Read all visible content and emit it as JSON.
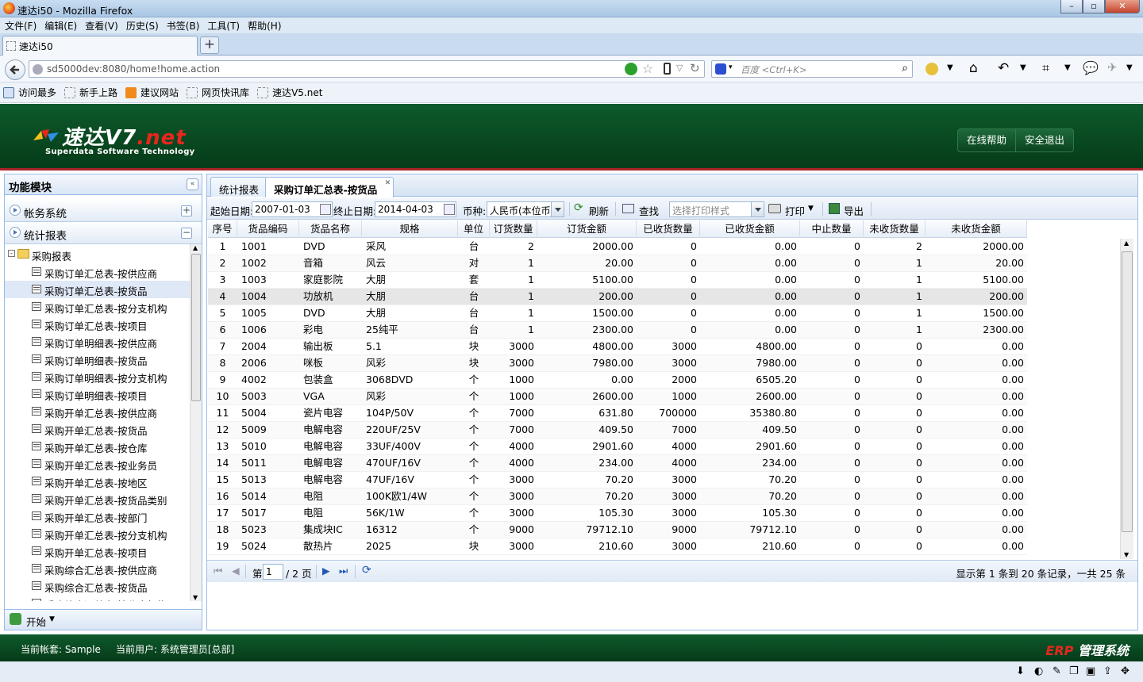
{
  "window": {
    "title": "速达i50 - Mozilla Firefox"
  },
  "menu": [
    "文件(F)",
    "编辑(E)",
    "查看(V)",
    "历史(S)",
    "书签(B)",
    "工具(T)",
    "帮助(H)"
  ],
  "browser_tab": {
    "label": "速达i50"
  },
  "address": {
    "url": "sd5000dev:8080/home!home.action",
    "search_placeholder": "百度 <Ctrl+K>"
  },
  "bookmarks": [
    "访问最多",
    "新手上路",
    "建议网站",
    "网页快讯库",
    "速达V5.net"
  ],
  "app": {
    "logo_main": "速达V7",
    "logo_net": ".net",
    "logo_sub": "Superdata Software Technology",
    "help_button": "在线帮助",
    "logout_button": "安全退出"
  },
  "sidebar": {
    "title": "功能模块",
    "sections": [
      {
        "label": "帐务系统",
        "toggle": "+"
      },
      {
        "label": "统计报表",
        "toggle": "−"
      }
    ],
    "folder": "采购报表",
    "items": [
      "采购订单汇总表-按供应商",
      "采购订单汇总表-按货品",
      "采购订单汇总表-按分支机构",
      "采购订单汇总表-按项目",
      "采购订单明细表-按供应商",
      "采购订单明细表-按货品",
      "采购订单明细表-按分支机构",
      "采购订单明细表-按项目",
      "采购开单汇总表-按供应商",
      "采购开单汇总表-按货品",
      "采购开单汇总表-按仓库",
      "采购开单汇总表-按业务员",
      "采购开单汇总表-按地区",
      "采购开单汇总表-按货品类别",
      "采购开单汇总表-按部门",
      "采购开单汇总表-按分支机构",
      "采购开单汇总表-按项目",
      "采购综合汇总表-按供应商",
      "采购综合汇总表-按货品",
      "采购综合汇总表-按分支机构"
    ],
    "selected_index": 1,
    "start": "开始"
  },
  "tabs": [
    {
      "label": "统计报表"
    },
    {
      "label": "采购订单汇总表-按货品"
    }
  ],
  "toolbar": {
    "start_label": "起始日期:",
    "start_value": "2007-01-03",
    "end_label": "终止日期:",
    "end_value": "2014-04-03",
    "currency_label": "币种:",
    "currency_value": "人民币(本位币",
    "refresh": "刷新",
    "find": "查找",
    "print_style_placeholder": "选择打印样式",
    "print": "打印",
    "export": "导出"
  },
  "table": {
    "columns": [
      "序号",
      "货品编码",
      "货品名称",
      "规格",
      "单位",
      "订货数量",
      "订货金额",
      "已收货数量",
      "已收货金额",
      "中止数量",
      "未收货数量",
      "未收货金额"
    ],
    "rows": [
      [
        "1",
        "1001",
        "DVD",
        "采风",
        "台",
        "2",
        "2000.00",
        "0",
        "0.00",
        "0",
        "2",
        "2000.00"
      ],
      [
        "2",
        "1002",
        "音箱",
        "风云",
        "对",
        "1",
        "20.00",
        "0",
        "0.00",
        "0",
        "1",
        "20.00"
      ],
      [
        "3",
        "1003",
        "家庭影院",
        "大朋",
        "套",
        "1",
        "5100.00",
        "0",
        "0.00",
        "0",
        "1",
        "5100.00"
      ],
      [
        "4",
        "1004",
        "功放机",
        "大朋",
        "台",
        "1",
        "200.00",
        "0",
        "0.00",
        "0",
        "1",
        "200.00"
      ],
      [
        "5",
        "1005",
        "DVD",
        "大朋",
        "台",
        "1",
        "1500.00",
        "0",
        "0.00",
        "0",
        "1",
        "1500.00"
      ],
      [
        "6",
        "1006",
        "彩电",
        "25纯平",
        "台",
        "1",
        "2300.00",
        "0",
        "0.00",
        "0",
        "1",
        "2300.00"
      ],
      [
        "7",
        "2004",
        "输出板",
        "5.1",
        "块",
        "3000",
        "4800.00",
        "3000",
        "4800.00",
        "0",
        "0",
        "0.00"
      ],
      [
        "8",
        "2006",
        "咪板",
        "风彩",
        "块",
        "3000",
        "7980.00",
        "3000",
        "7980.00",
        "0",
        "0",
        "0.00"
      ],
      [
        "9",
        "4002",
        "包装盒",
        "3068DVD",
        "个",
        "1000",
        "0.00",
        "2000",
        "6505.20",
        "0",
        "0",
        "0.00"
      ],
      [
        "10",
        "5003",
        "VGA",
        "风彩",
        "个",
        "1000",
        "2600.00",
        "1000",
        "2600.00",
        "0",
        "0",
        "0.00"
      ],
      [
        "11",
        "5004",
        "瓷片电容",
        "104P/50V",
        "个",
        "7000",
        "631.80",
        "700000",
        "35380.80",
        "0",
        "0",
        "0.00"
      ],
      [
        "12",
        "5009",
        "电解电容",
        "220UF/25V",
        "个",
        "7000",
        "409.50",
        "7000",
        "409.50",
        "0",
        "0",
        "0.00"
      ],
      [
        "13",
        "5010",
        "电解电容",
        "33UF/400V",
        "个",
        "4000",
        "2901.60",
        "4000",
        "2901.60",
        "0",
        "0",
        "0.00"
      ],
      [
        "14",
        "5011",
        "电解电容",
        "470UF/16V",
        "个",
        "4000",
        "234.00",
        "4000",
        "234.00",
        "0",
        "0",
        "0.00"
      ],
      [
        "15",
        "5013",
        "电解电容",
        "47UF/16V",
        "个",
        "3000",
        "70.20",
        "3000",
        "70.20",
        "0",
        "0",
        "0.00"
      ],
      [
        "16",
        "5014",
        "电阻",
        "100K欧1/4W",
        "个",
        "3000",
        "70.20",
        "3000",
        "70.20",
        "0",
        "0",
        "0.00"
      ],
      [
        "17",
        "5017",
        "电阻",
        "56K/1W",
        "个",
        "3000",
        "105.30",
        "3000",
        "105.30",
        "0",
        "0",
        "0.00"
      ],
      [
        "18",
        "5023",
        "集成块IC",
        "16312",
        "个",
        "9000",
        "79712.10",
        "9000",
        "79712.10",
        "0",
        "0",
        "0.00"
      ],
      [
        "19",
        "5024",
        "散热片",
        "2025",
        "块",
        "3000",
        "210.60",
        "3000",
        "210.60",
        "0",
        "0",
        "0.00"
      ]
    ],
    "highlighted_row": 4
  },
  "pager": {
    "page_label": "第",
    "page_value": "1",
    "total_pages": "/ 2 页",
    "info": "显示第 1 条到 20 条记录，一共 25 条"
  },
  "footer": {
    "account": "当前帐套: Sample",
    "user": "当前用户: 系统管理员[总部]",
    "erp": "ERP",
    "system": "管理系统"
  }
}
